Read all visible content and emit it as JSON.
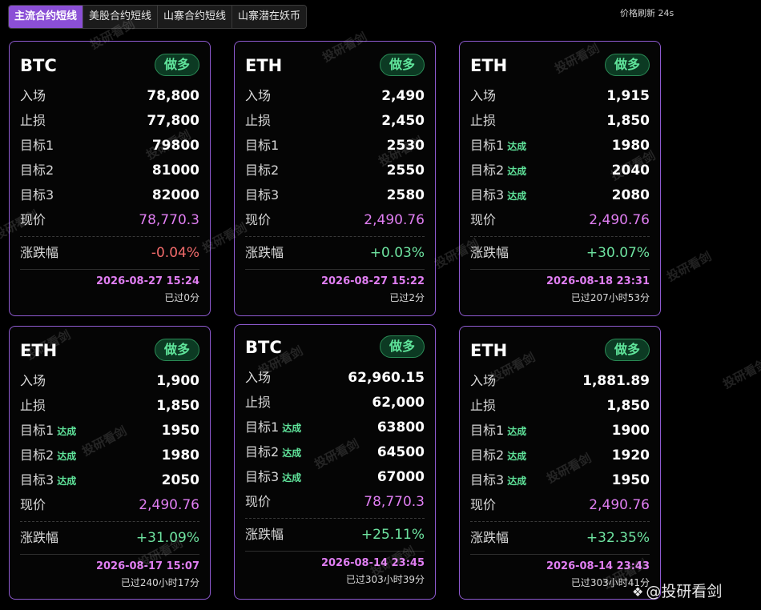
{
  "tabs": [
    "主流合约短线",
    "美股合约短线",
    "山寨合约短线",
    "山寨潜在妖币"
  ],
  "refresh_text": "价格刷新 24s",
  "labels": {
    "entry": "入场",
    "stop": "止损",
    "target1": "目标1",
    "target2": "目标2",
    "target3": "目标3",
    "price": "现价",
    "change": "涨跌幅",
    "reached": "达成"
  },
  "cards": [
    {
      "symbol": "BTC",
      "side": "做多",
      "entry": "78,800",
      "stop": "77,800",
      "t1": "79800",
      "t2": "81000",
      "t3": "82000",
      "t1_reached": false,
      "t2_reached": false,
      "t3_reached": false,
      "price": "78,770.3",
      "change": "-0.04%",
      "change_dir": "neg",
      "time": "2026-08-27 15:24",
      "ago": "已过0分"
    },
    {
      "symbol": "ETH",
      "side": "做多",
      "entry": "2,490",
      "stop": "2,450",
      "t1": "2530",
      "t2": "2550",
      "t3": "2580",
      "t1_reached": false,
      "t2_reached": false,
      "t3_reached": false,
      "price": "2,490.76",
      "change": "+0.03%",
      "change_dir": "pos",
      "time": "2026-08-27 15:22",
      "ago": "已过2分"
    },
    {
      "symbol": "ETH",
      "side": "做多",
      "entry": "1,915",
      "stop": "1,850",
      "t1": "1980",
      "t2": "2040",
      "t3": "2080",
      "t1_reached": true,
      "t2_reached": true,
      "t3_reached": true,
      "price": "2,490.76",
      "change": "+30.07%",
      "change_dir": "pos",
      "time": "2026-08-18 23:31",
      "ago": "已过207小时53分"
    },
    {
      "symbol": "ETH",
      "side": "做多",
      "entry": "1,900",
      "stop": "1,850",
      "t1": "1950",
      "t2": "1980",
      "t3": "2050",
      "t1_reached": true,
      "t2_reached": true,
      "t3_reached": true,
      "price": "2,490.76",
      "change": "+31.09%",
      "change_dir": "pos",
      "time": "2026-08-17 15:07",
      "ago": "已过240小时17分"
    },
    {
      "symbol": "BTC",
      "side": "做多",
      "entry": "62,960.15",
      "stop": "62,000",
      "t1": "63800",
      "t2": "64500",
      "t3": "67000",
      "t1_reached": true,
      "t2_reached": true,
      "t3_reached": true,
      "price": "78,770.3",
      "change": "+25.11%",
      "change_dir": "pos",
      "time": "2026-08-14 23:45",
      "ago": "已过303小时39分"
    },
    {
      "symbol": "ETH",
      "side": "做多",
      "entry": "1,881.89",
      "stop": "1,850",
      "t1": "1900",
      "t2": "1920",
      "t3": "1950",
      "t1_reached": true,
      "t2_reached": true,
      "t3_reached": true,
      "price": "2,490.76",
      "change": "+32.35%",
      "change_dir": "pos",
      "time": "2026-08-14 23:43",
      "ago": "已过303小时41分"
    }
  ],
  "watermark": "投研看剑",
  "logo_text": "@投研看剑"
}
